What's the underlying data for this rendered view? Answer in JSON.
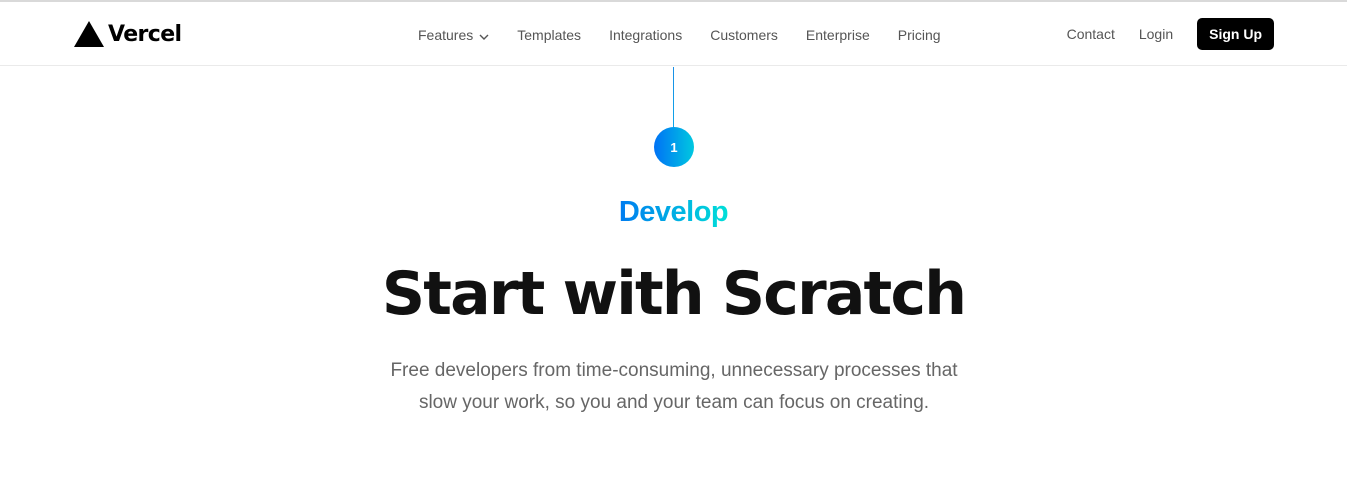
{
  "brand": {
    "name": "Vercel",
    "logo_icon": "triangle-logo-icon"
  },
  "nav": {
    "links": [
      {
        "label": "Features",
        "has_dropdown": true
      },
      {
        "label": "Templates"
      },
      {
        "label": "Integrations"
      },
      {
        "label": "Customers"
      },
      {
        "label": "Enterprise"
      },
      {
        "label": "Pricing"
      }
    ],
    "right": {
      "contact": "Contact",
      "login": "Login",
      "signup": "Sign Up"
    }
  },
  "hero": {
    "step_number": "1",
    "eyebrow": "Develop",
    "title": "Start with Scratch",
    "description_line1": "Free developers from time-consuming, unnecessary processes that",
    "description_line2": "slow your work, so you and your team can focus on creating."
  },
  "colors": {
    "gradient_start": "#007cf0",
    "gradient_end": "#00dfd8",
    "signup_bg": "#000000"
  }
}
